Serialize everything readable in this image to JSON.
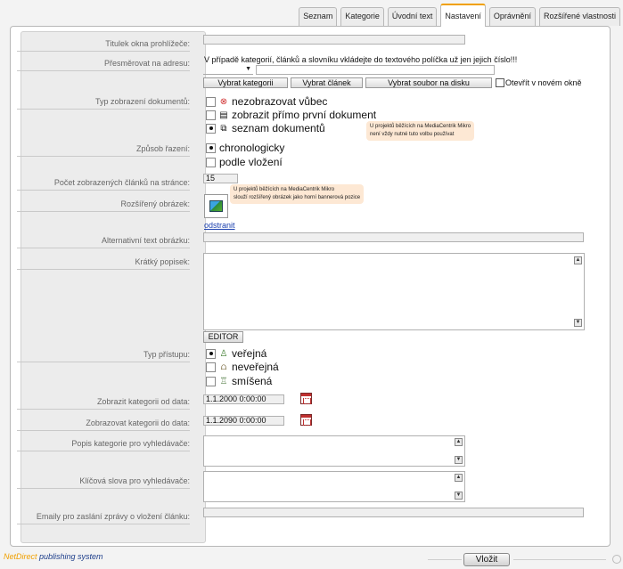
{
  "tabs": [
    "Seznam",
    "Kategorie",
    "Úvodní text",
    "Nastavení",
    "Oprávnění",
    "Rozšířené vlastnosti"
  ],
  "active_tab": "Nastavení",
  "labels": {
    "window_title": "Titulek okna prohlížeče:",
    "redirect": "Přesměrovat na adresu:",
    "doc_display": "Typ zobrazení dokumentů:",
    "sorting": "Způsob řazení:",
    "per_page": "Počet zobrazených článků na stránce:",
    "ext_image": "Rozšířený obrázek:",
    "alt_text": "Alternativní text obrázku:",
    "short_desc": "Krátký popisek:",
    "access": "Typ přístupu:",
    "date_from": "Zobrazit kategorii od data:",
    "date_to": "Zobrazovat kategorii do data:",
    "seo_desc": "Popis kategorie pro vyhledávače:",
    "seo_keywords": "Klíčová slova pro vyhledávače:",
    "emails": "Emaily pro zaslání zprávy o vložení článku:"
  },
  "redirect": {
    "note": "V případě kategorií, článků a slovníku vkládejte do textového políčka už jen jejich číslo!!!",
    "select_category": "Vybrat kategorii",
    "select_article": "Vybrat článek",
    "select_file": "Vybrat soubor na disku",
    "new_window": "Otevřít v novém okně"
  },
  "doc_display_options": [
    {
      "label": "nezobrazovat vůbec",
      "icon": "forbidden-icon",
      "glyph": "⊗",
      "color": "#d03030",
      "checked": false
    },
    {
      "label": "zobrazit přímo první dokument",
      "icon": "document-icon",
      "glyph": "▤",
      "color": "#333333",
      "checked": false
    },
    {
      "label": "seznam dokumentů",
      "icon": "document-list-icon",
      "glyph": "⧉",
      "color": "#333333",
      "checked": true
    }
  ],
  "doc_display_hint": [
    "U projektů běžících na MediaCentrik Mikro",
    "není vždy nutné tuto volbu používat"
  ],
  "sorting_options": [
    {
      "label": "chronologicky",
      "checked": true
    },
    {
      "label": "podle vložení",
      "checked": false
    }
  ],
  "per_page_value": "15",
  "image_hint": [
    "U projektů běžících na MediaCentrik Mikro",
    "slouží rozšířený obrázek jako horní bannerová pozice"
  ],
  "image_remove": "odstranit",
  "editor_button": "EDITOR",
  "access_options": [
    {
      "label": "veřejná",
      "icon": "public-user-icon",
      "glyph": "♙",
      "color": "#3a7a2a",
      "checked": true
    },
    {
      "label": "neveřejná",
      "icon": "lock-icon",
      "glyph": "⩍",
      "color": "#6a5a2a",
      "checked": false
    },
    {
      "label": "smíšená",
      "icon": "mixed-users-icon",
      "glyph": "♖",
      "color": "#3a6a2a",
      "checked": false
    }
  ],
  "date_from_value": "1.1.2000 0:00:00",
  "date_to_value": "1.1.2090 0:00:00",
  "footer": {
    "brand_prefix": "NetDirect",
    "brand_suffix": " publishing system",
    "submit": "Vložit"
  },
  "colors": {
    "accent": "#f0a000",
    "link": "#1a3fae",
    "hint_bg": "#fde8d4"
  }
}
